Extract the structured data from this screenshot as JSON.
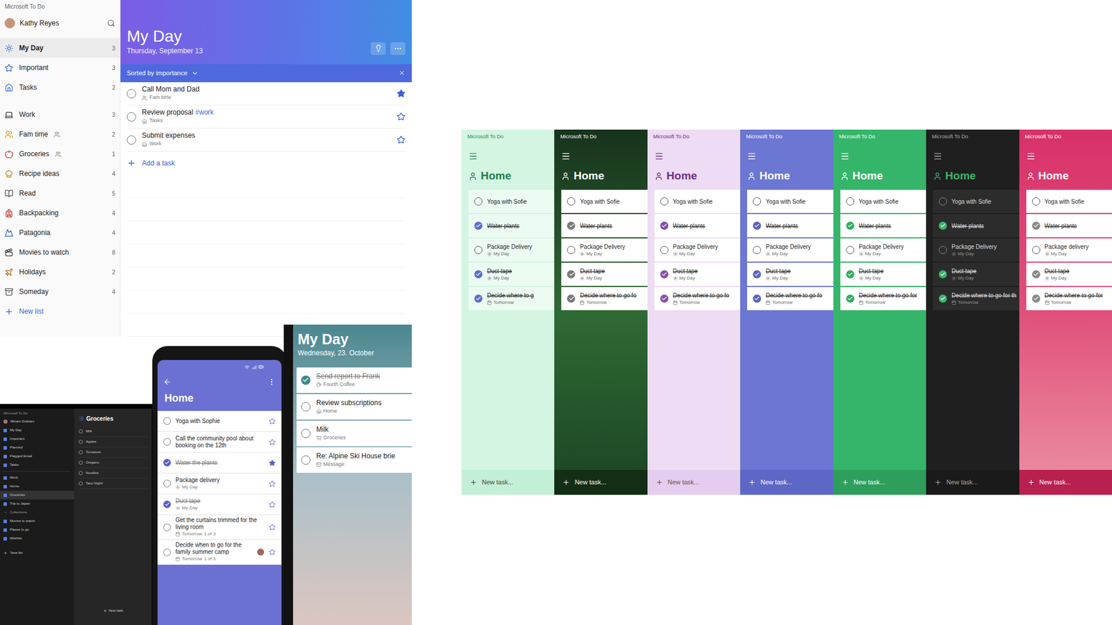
{
  "desktop": {
    "app_title": "Microsoft To Do",
    "user": "Kathy Reyes",
    "smart_lists": [
      {
        "label": "My Day",
        "count": "3",
        "selected": true
      },
      {
        "label": "Important",
        "count": "3",
        "selected": false
      },
      {
        "label": "Tasks",
        "count": "2",
        "selected": false
      }
    ],
    "lists": [
      {
        "label": "Work",
        "count": "3",
        "shared": false,
        "selected": false
      },
      {
        "label": "Fam time",
        "count": "2",
        "shared": true,
        "selected": false
      },
      {
        "label": "Groceries",
        "count": "1",
        "shared": true,
        "selected": false
      },
      {
        "label": "Recipe ideas",
        "count": "4",
        "shared": false,
        "selected": false
      },
      {
        "label": "Read",
        "count": "5",
        "shared": false,
        "selected": false
      },
      {
        "label": "Backpacking",
        "count": "4",
        "shared": false,
        "selected": false
      },
      {
        "label": "Patagonia",
        "count": "4",
        "shared": false,
        "selected": false
      },
      {
        "label": "Movies to watch",
        "count": "8",
        "shared": false,
        "selected": false
      },
      {
        "label": "Holidays",
        "count": "2",
        "shared": false,
        "selected": false
      },
      {
        "label": "Someday",
        "count": "4",
        "shared": false,
        "selected": false
      }
    ],
    "new_list": "New list",
    "header": {
      "title": "My Day",
      "date": "Thursday, September 13"
    },
    "sort": {
      "label": "Sorted by importance"
    },
    "tasks": [
      {
        "title": "Call Mom and Dad",
        "tag": "",
        "list": "Fam time",
        "important": true,
        "done": false
      },
      {
        "title": "Review proposal",
        "tag": "#work",
        "list": "Tasks",
        "important": false,
        "done": false
      },
      {
        "title": "Submit expenses",
        "tag": "",
        "list": "Work",
        "important": false,
        "done": false
      }
    ],
    "add_task": "Add a task"
  },
  "laptop": {
    "app_title": "Microsoft To Do",
    "user": "Miriam Graham",
    "nav": [
      {
        "label": "My Day",
        "selected": false
      },
      {
        "label": "Important",
        "selected": false
      },
      {
        "label": "Planned",
        "selected": false
      },
      {
        "label": "Flagged Email",
        "selected": false
      },
      {
        "label": "Tasks",
        "selected": false
      }
    ],
    "lists": [
      {
        "label": "Work",
        "selected": false
      },
      {
        "label": "Home",
        "selected": false
      },
      {
        "label": "Groceries",
        "selected": true
      },
      {
        "label": "Trip to Japan",
        "selected": false
      }
    ],
    "group_label": "Collections",
    "group_lists": [
      {
        "label": "Movies to watch",
        "selected": false
      },
      {
        "label": "Places to go",
        "selected": false
      },
      {
        "label": "Wishlist",
        "selected": false
      }
    ],
    "new_list": "New list",
    "pane_title": "Groceries",
    "items": [
      {
        "title": "Milk",
        "done": false
      },
      {
        "title": "Apples",
        "done": false
      },
      {
        "title": "Tomatoes",
        "done": false
      },
      {
        "title": "Oregano",
        "done": false
      },
      {
        "title": "Noodles",
        "done": false
      },
      {
        "title": "Taco Night!",
        "done": false
      }
    ],
    "new_task": "New task"
  },
  "phone_home": {
    "title": "Home",
    "tasks": [
      {
        "title": "Yoga with Sophie",
        "sub": "",
        "steps": "",
        "kind": "none",
        "done": false,
        "important": false,
        "assigned": false
      },
      {
        "title": "Call the community pool about booking on the 12th",
        "sub": "",
        "steps": "",
        "kind": "none",
        "done": false,
        "important": false,
        "assigned": false
      },
      {
        "title": "Water the plants",
        "sub": "",
        "steps": "",
        "kind": "none",
        "done": true,
        "important": true,
        "assigned": false
      },
      {
        "title": "Package delivery",
        "sub": "My Day",
        "steps": "",
        "kind": "myday",
        "done": false,
        "important": false,
        "assigned": false
      },
      {
        "title": "Duct tape",
        "sub": "My Day",
        "steps": "",
        "kind": "myday",
        "done": true,
        "important": false,
        "assigned": false
      },
      {
        "title": "Get the curtains trimmed for the living room",
        "sub": "Tomorrow",
        "steps": "1 of 3",
        "kind": "due",
        "done": false,
        "important": false,
        "assigned": false
      },
      {
        "title": "Decide when to go for the family summer camp",
        "sub": "Tomorrow",
        "steps": "1 of 3",
        "kind": "due",
        "done": false,
        "important": false,
        "assigned": true
      }
    ]
  },
  "phone_myday": {
    "title": "My Day",
    "date": "Wednesday, 23. October",
    "tasks": [
      {
        "title": "Send report to Frank",
        "list": "Fourth Coffee",
        "done": true
      },
      {
        "title": "Review subscriptions",
        "list": "Home",
        "done": false
      },
      {
        "title": "Milk",
        "list": "Groceries",
        "done": false
      },
      {
        "title": "Re: Alpine Ski House brie",
        "list": "Message",
        "done": false
      }
    ]
  },
  "themes": [
    {
      "kind": "mint",
      "color": "#d4f5e2",
      "app_title": "Microsoft To Do",
      "title": "Home",
      "new_task": "New task...",
      "tasks": [
        {
          "title": "Yoga with Sofie",
          "sub": "",
          "kind": "none",
          "done": false
        },
        {
          "title": "Water plants",
          "sub": "",
          "kind": "none",
          "done": true
        },
        {
          "title": "Package Delivery",
          "sub": "My Day",
          "kind": "myday",
          "done": false
        },
        {
          "title": "Duct tape",
          "sub": "My Day",
          "kind": "myday",
          "done": true
        },
        {
          "title": "Decide where to g",
          "sub": "Tomorrow",
          "kind": "due",
          "done": true
        }
      ]
    },
    {
      "kind": "photo",
      "color": "#2a5e30",
      "app_title": "Microsoft To Do",
      "title": "Home",
      "new_task": "New task...",
      "tasks": [
        {
          "title": "Yoga with Sofie",
          "sub": "",
          "kind": "none",
          "done": false
        },
        {
          "title": "Water plants",
          "sub": "",
          "kind": "none",
          "done": true
        },
        {
          "title": "Package Delivery",
          "sub": "My Day",
          "kind": "myday",
          "done": false
        },
        {
          "title": "Duct tape",
          "sub": "My Day",
          "kind": "myday",
          "done": true
        },
        {
          "title": "Decide where to go fo",
          "sub": "Tomorrow",
          "kind": "due",
          "done": true
        }
      ]
    },
    {
      "kind": "lavender",
      "color": "#eddcf3",
      "app_title": "Microsoft To Do",
      "title": "Home",
      "new_task": "New task...",
      "tasks": [
        {
          "title": "Yoga with Sofie",
          "sub": "",
          "kind": "none",
          "done": false
        },
        {
          "title": "Water plants",
          "sub": "",
          "kind": "none",
          "done": true
        },
        {
          "title": "Package Delivery",
          "sub": "My Day",
          "kind": "myday",
          "done": false
        },
        {
          "title": "Duct tape",
          "sub": "My Day",
          "kind": "myday",
          "done": true
        },
        {
          "title": "Decide where to go fo",
          "sub": "Tomorrow",
          "kind": "due",
          "done": true
        }
      ]
    },
    {
      "kind": "periwinkle",
      "color": "#6c76d3",
      "app_title": "Microsoft To Do",
      "title": "Home",
      "new_task": "New task...",
      "tasks": [
        {
          "title": "Yoga with Sofie",
          "sub": "",
          "kind": "none",
          "done": false
        },
        {
          "title": "Water plants",
          "sub": "",
          "kind": "none",
          "done": true
        },
        {
          "title": "Package Delivery",
          "sub": "My Day",
          "kind": "myday",
          "done": false
        },
        {
          "title": "Duct tape",
          "sub": "My Day",
          "kind": "myday",
          "done": true
        },
        {
          "title": "Decide where to go fo",
          "sub": "Tomorrow",
          "kind": "due",
          "done": true
        }
      ]
    },
    {
      "kind": "green",
      "color": "#35b56a",
      "app_title": "Microsoft To Do",
      "title": "Home",
      "new_task": "New task...",
      "tasks": [
        {
          "title": "Yoga with Sofie",
          "sub": "",
          "kind": "none",
          "done": false
        },
        {
          "title": "Water plants",
          "sub": "",
          "kind": "none",
          "done": true
        },
        {
          "title": "Package Delivery",
          "sub": "My Day",
          "kind": "myday",
          "done": false
        },
        {
          "title": "Duct tape",
          "sub": "My Day",
          "kind": "myday",
          "done": true
        },
        {
          "title": "Decide where to go for",
          "sub": "Tomorrow",
          "kind": "due",
          "done": true
        }
      ]
    },
    {
      "kind": "dark",
      "color": "#1f1f1f",
      "app_title": "Microsoft To Do",
      "title": "Home",
      "new_task": "New task...",
      "tasks": [
        {
          "title": "Yoga with Sofie",
          "sub": "",
          "kind": "none",
          "done": false
        },
        {
          "title": "Water plants",
          "sub": "",
          "kind": "none",
          "done": true
        },
        {
          "title": "Package Delivery",
          "sub": "My Day",
          "kind": "myday",
          "done": false
        },
        {
          "title": "Duct tape",
          "sub": "My Day",
          "kind": "myday",
          "done": true
        },
        {
          "title": "Decide where to go for th",
          "sub": "Tomorrow",
          "kind": "due",
          "done": true
        }
      ]
    },
    {
      "kind": "pink",
      "color": "#d8306a",
      "app_title": "Microsoft To Do",
      "title": "Home",
      "new_task": "New task...",
      "tasks": [
        {
          "title": "Yoga with Sofie",
          "sub": "",
          "kind": "none",
          "done": false
        },
        {
          "title": "Water plants",
          "sub": "",
          "kind": "none",
          "done": true
        },
        {
          "title": "Package delivery",
          "sub": "My Day",
          "kind": "myday",
          "done": false
        },
        {
          "title": "Duct tape",
          "sub": "My Day",
          "kind": "myday",
          "done": true
        },
        {
          "title": "Decide where to go for",
          "sub": "Tomorrow",
          "kind": "due",
          "done": true
        }
      ]
    }
  ]
}
